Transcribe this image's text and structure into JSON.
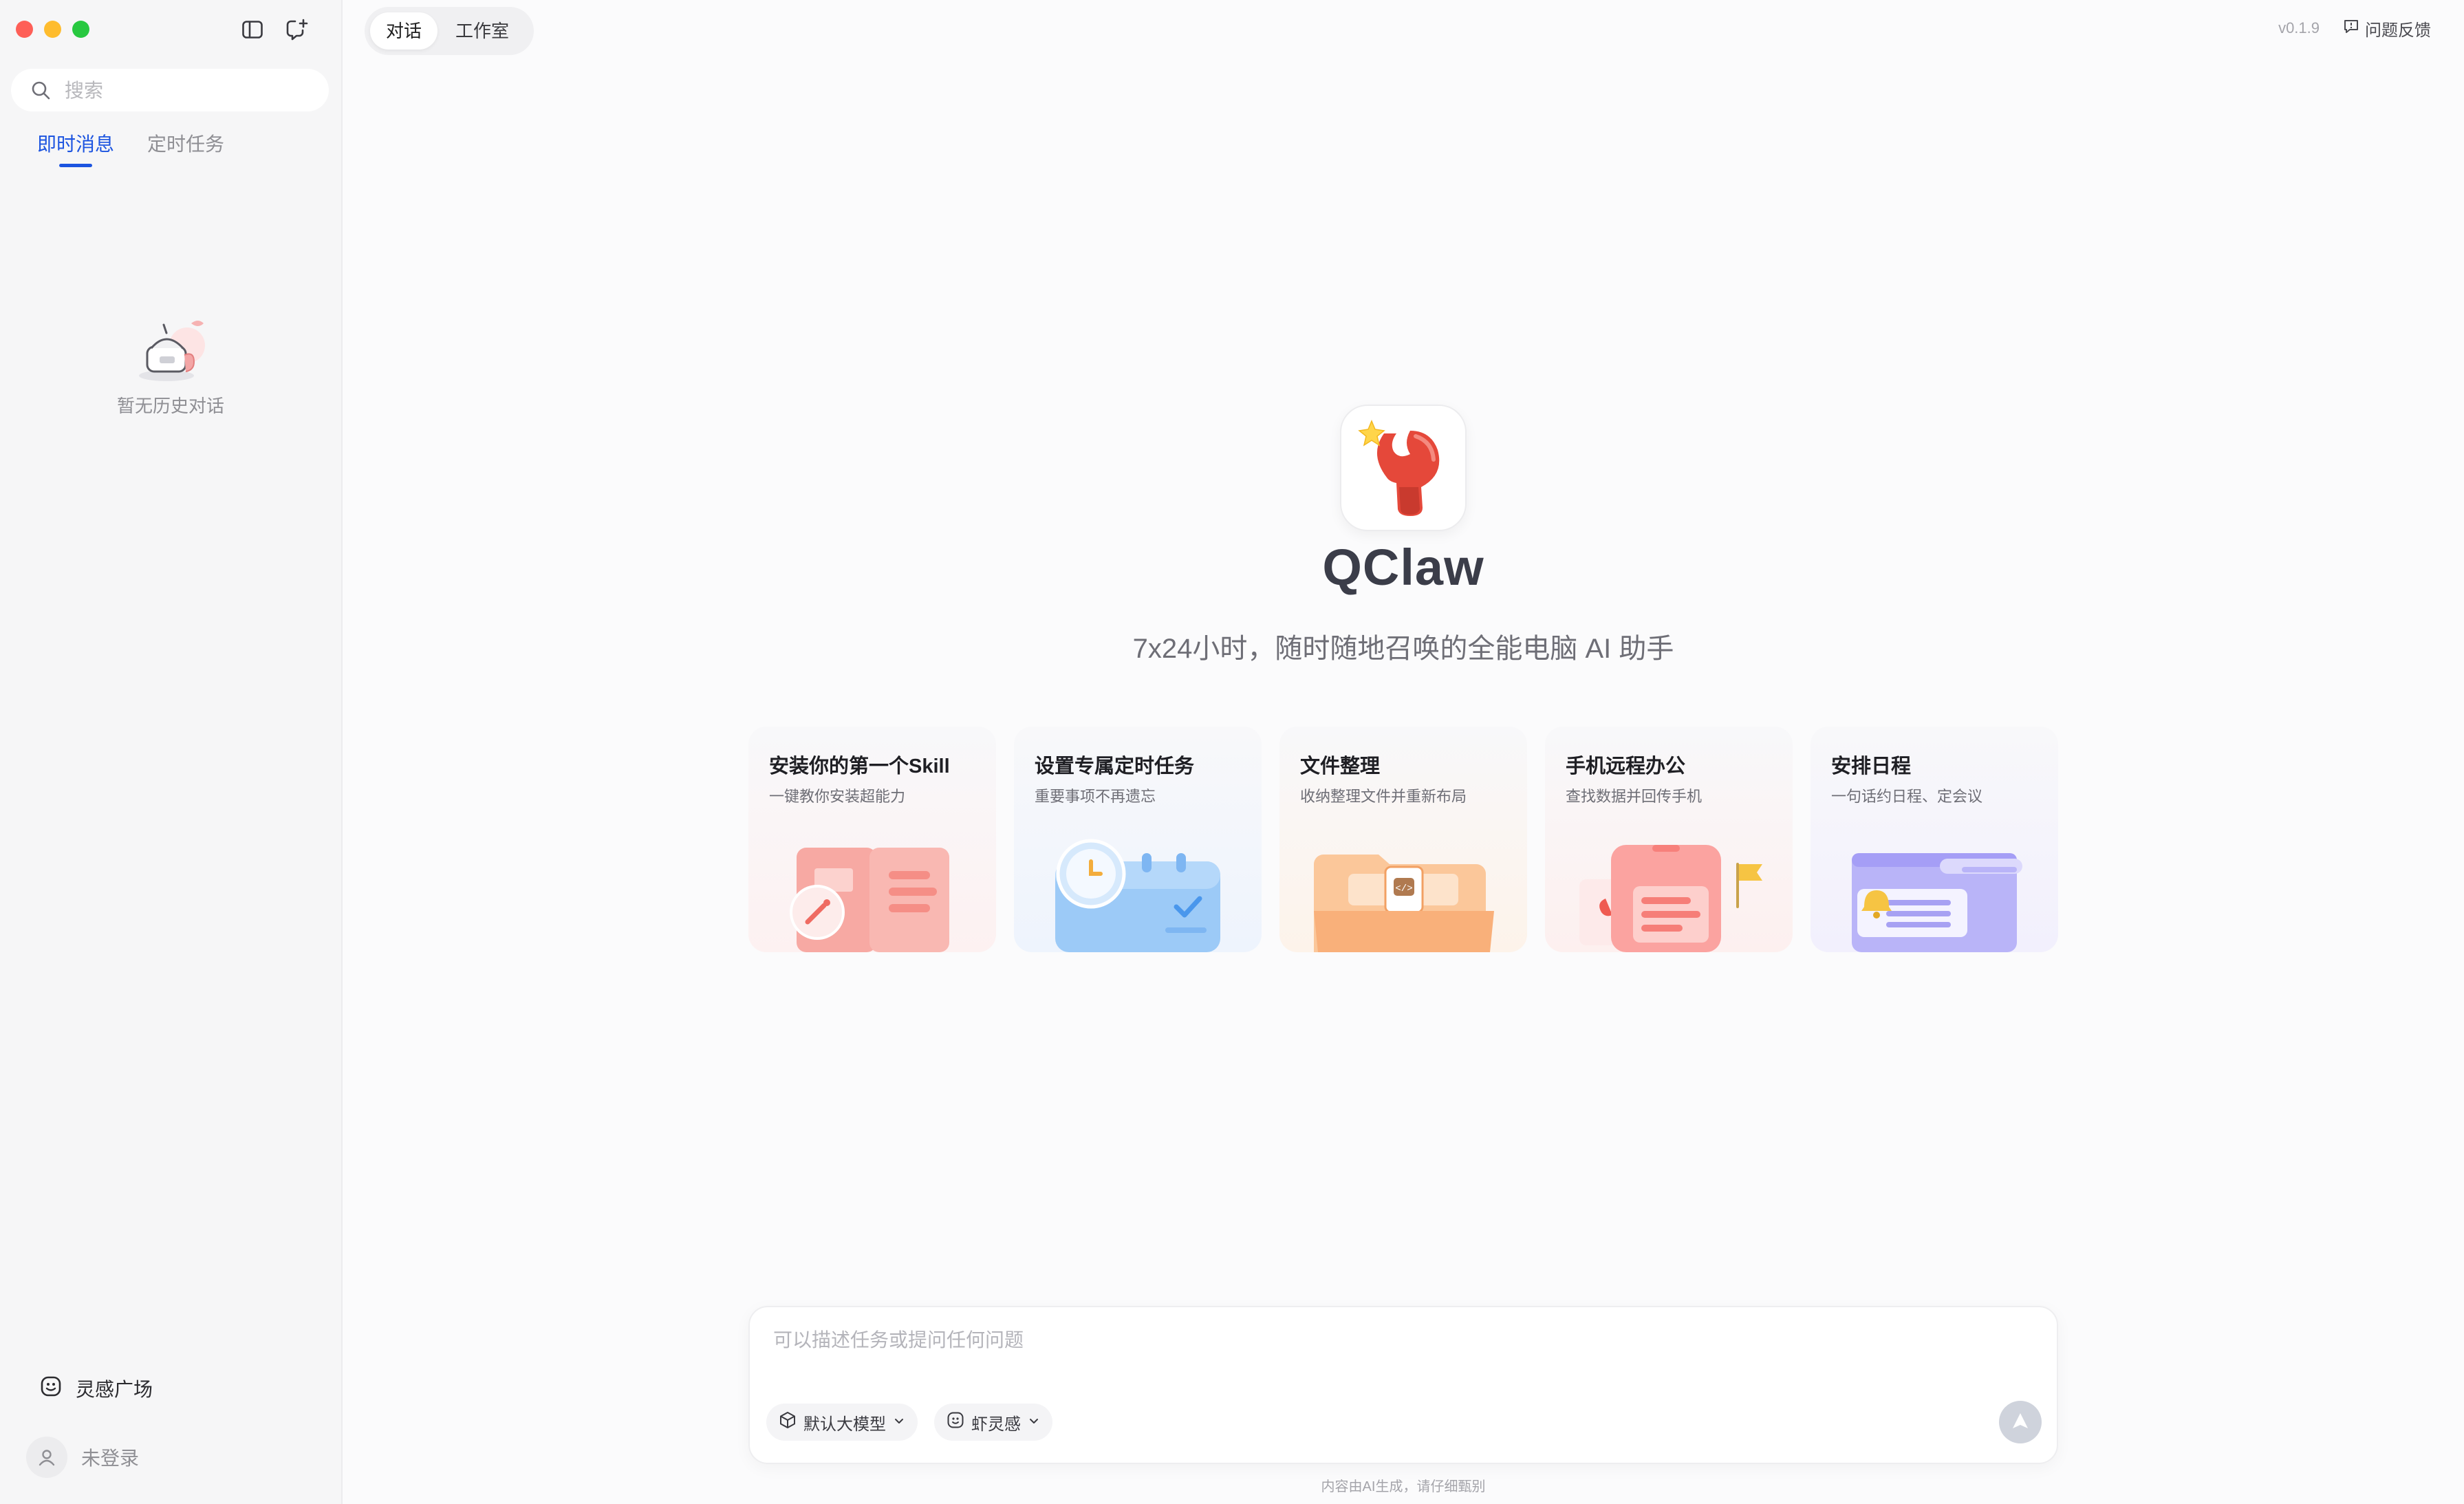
{
  "sidebar": {
    "search_placeholder": "搜索",
    "tabs": [
      {
        "label": "即时消息",
        "active": true
      },
      {
        "label": "定时任务",
        "active": false
      }
    ],
    "empty_text": "暂无历史对话",
    "inspiration_label": "灵感广场",
    "user_label": "未登录"
  },
  "header": {
    "segments": [
      {
        "label": "对话",
        "active": true
      },
      {
        "label": "工作室",
        "active": false
      }
    ],
    "version": "v0.1.9",
    "feedback_label": "问题反馈"
  },
  "hero": {
    "brand": "QClaw",
    "subtitle": "7x24小时，随时随地召唤的全能电脑 AI 助手"
  },
  "cards": [
    {
      "title": "安装你的第一个Skill",
      "subtitle": "一键教你安装超能力",
      "icon": "book-wand-illustration"
    },
    {
      "title": "设置专属定时任务",
      "subtitle": "重要事项不再遗忘",
      "icon": "clock-calendar-illustration"
    },
    {
      "title": "文件整理",
      "subtitle": "收纳整理文件并重新布局",
      "icon": "folder-illustration"
    },
    {
      "title": "手机远程办公",
      "subtitle": "查找数据并回传手机",
      "icon": "phone-flag-illustration"
    },
    {
      "title": "安排日程",
      "subtitle": "一句话约日程、定会议",
      "icon": "schedule-bell-illustration"
    }
  ],
  "composer": {
    "placeholder": "可以描述任务或提问任何问题",
    "model_chip": "默认大模型",
    "inspiration_chip": "虾灵感"
  },
  "footer": {
    "disclaimer": "内容由AI生成，请仔细甄别"
  },
  "colors": {
    "accent": "#1c54e0",
    "brand_text": "#3b3d49",
    "logo_red": "#e5483a"
  }
}
